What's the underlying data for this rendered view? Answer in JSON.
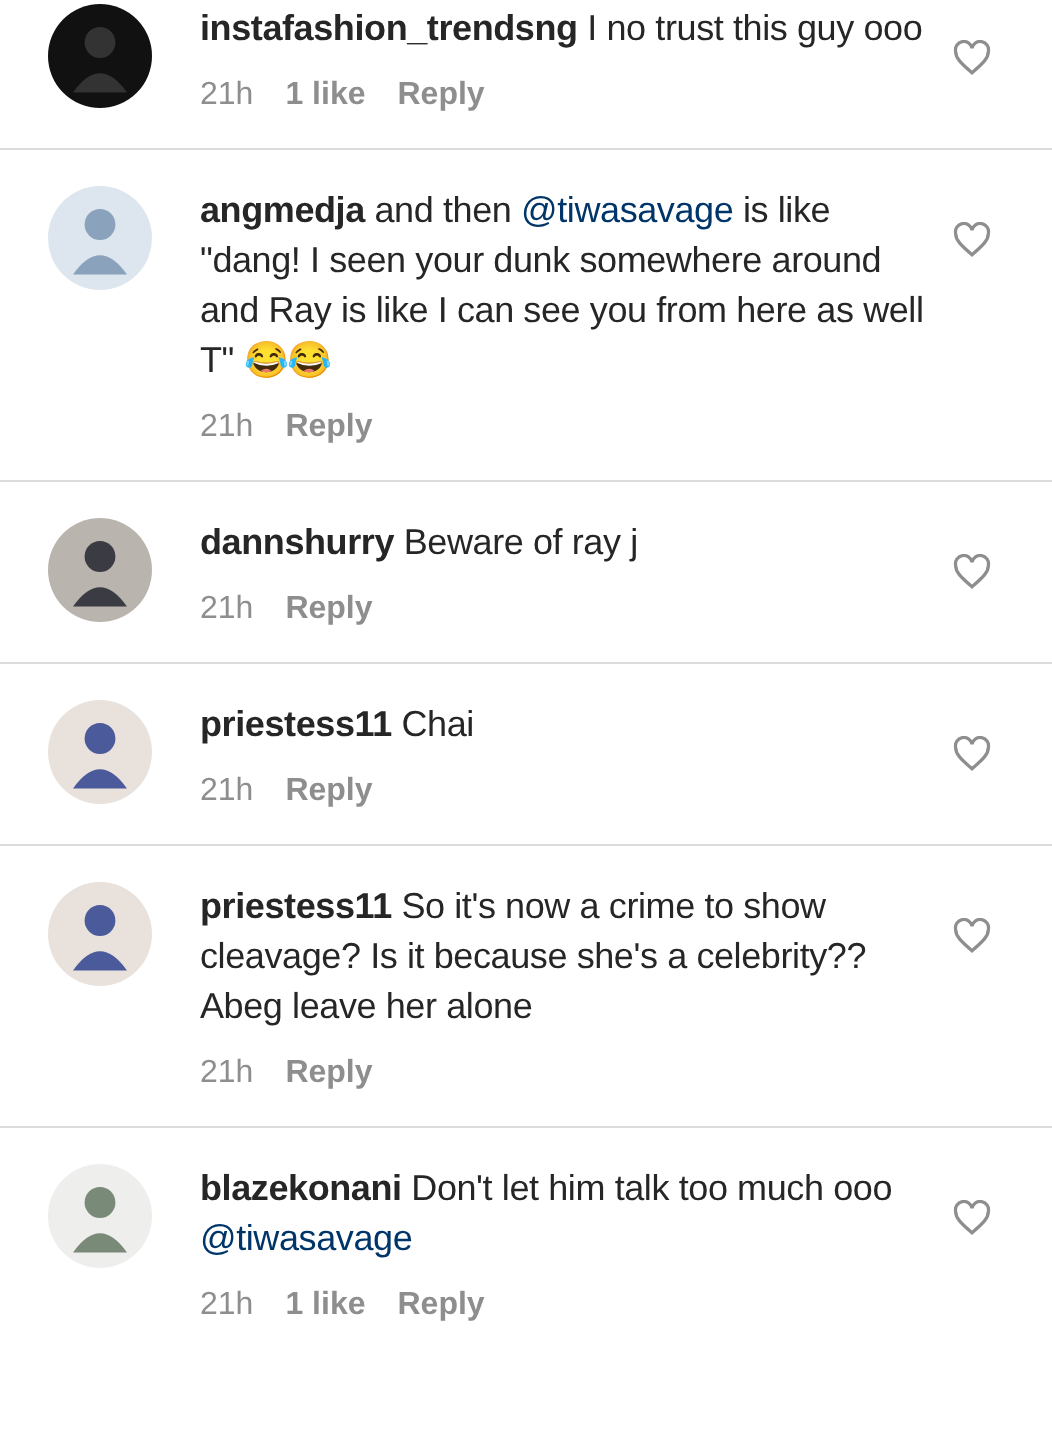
{
  "comments": [
    {
      "username": "instafashion_trendsng",
      "segments": [
        {
          "kind": "text",
          "text": "I no trust this guy ooo"
        }
      ],
      "time": "21h",
      "likes": "1 like",
      "reply": "Reply"
    },
    {
      "username": "angmedja",
      "segments": [
        {
          "kind": "text",
          "text": "and then "
        },
        {
          "kind": "mention",
          "text": "@tiwasavage"
        },
        {
          "kind": "text",
          "text": " is like \"dang! I seen your dunk somewhere around and Ray is like I can see you from here as well T\" 😂😂"
        }
      ],
      "time": "21h",
      "reply": "Reply"
    },
    {
      "username": "dannshurry",
      "segments": [
        {
          "kind": "text",
          "text": "Beware of ray j"
        }
      ],
      "time": "21h",
      "reply": "Reply"
    },
    {
      "username": "priestess11",
      "segments": [
        {
          "kind": "text",
          "text": "Chai"
        }
      ],
      "time": "21h",
      "reply": "Reply"
    },
    {
      "username": "priestess11",
      "segments": [
        {
          "kind": "text",
          "text": "So it's now a crime to show cleavage? Is it because she's a celebrity?? Abeg leave her alone"
        }
      ],
      "time": "21h",
      "reply": "Reply"
    },
    {
      "username": "blazekonani",
      "segments": [
        {
          "kind": "text",
          "text": "Don't let him talk too much ooo "
        },
        {
          "kind": "mention",
          "text": "@tiwasavage"
        }
      ],
      "time": "21h",
      "likes": "1 like",
      "reply": "Reply"
    }
  ]
}
